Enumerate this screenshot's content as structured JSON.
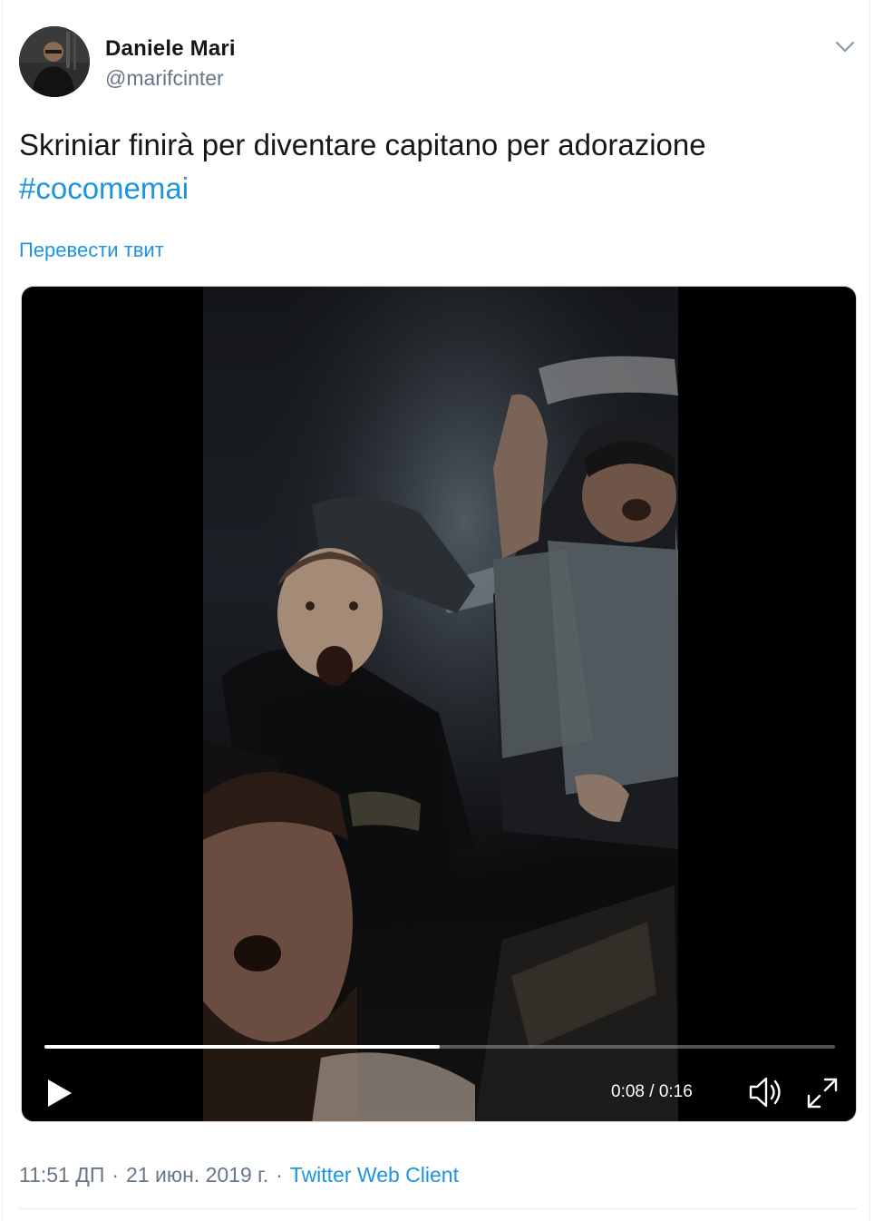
{
  "tweet": {
    "author": {
      "display_name": "Daniele Mari",
      "handle": "@marifcinter"
    },
    "text": "Skriniar finirà per diventare capitano per adorazione",
    "hashtag": "#cocomemai",
    "translate_label": "Перевести твит",
    "video": {
      "progress": 0.5,
      "current_time": "0:08",
      "duration": "0:16"
    },
    "meta": {
      "time": "11:51 ДП",
      "separator": "·",
      "date": "21 июн. 2019 г.",
      "client": "Twitter Web Client"
    }
  },
  "colors": {
    "link": "#1b95e0",
    "secondary_text": "#657786",
    "primary_text": "#14171a",
    "divider": "#e6ecf0"
  },
  "icons": {
    "caret": "chevron-down-icon",
    "play": "play-icon",
    "volume": "volume-icon",
    "fullscreen": "fullscreen-icon"
  }
}
